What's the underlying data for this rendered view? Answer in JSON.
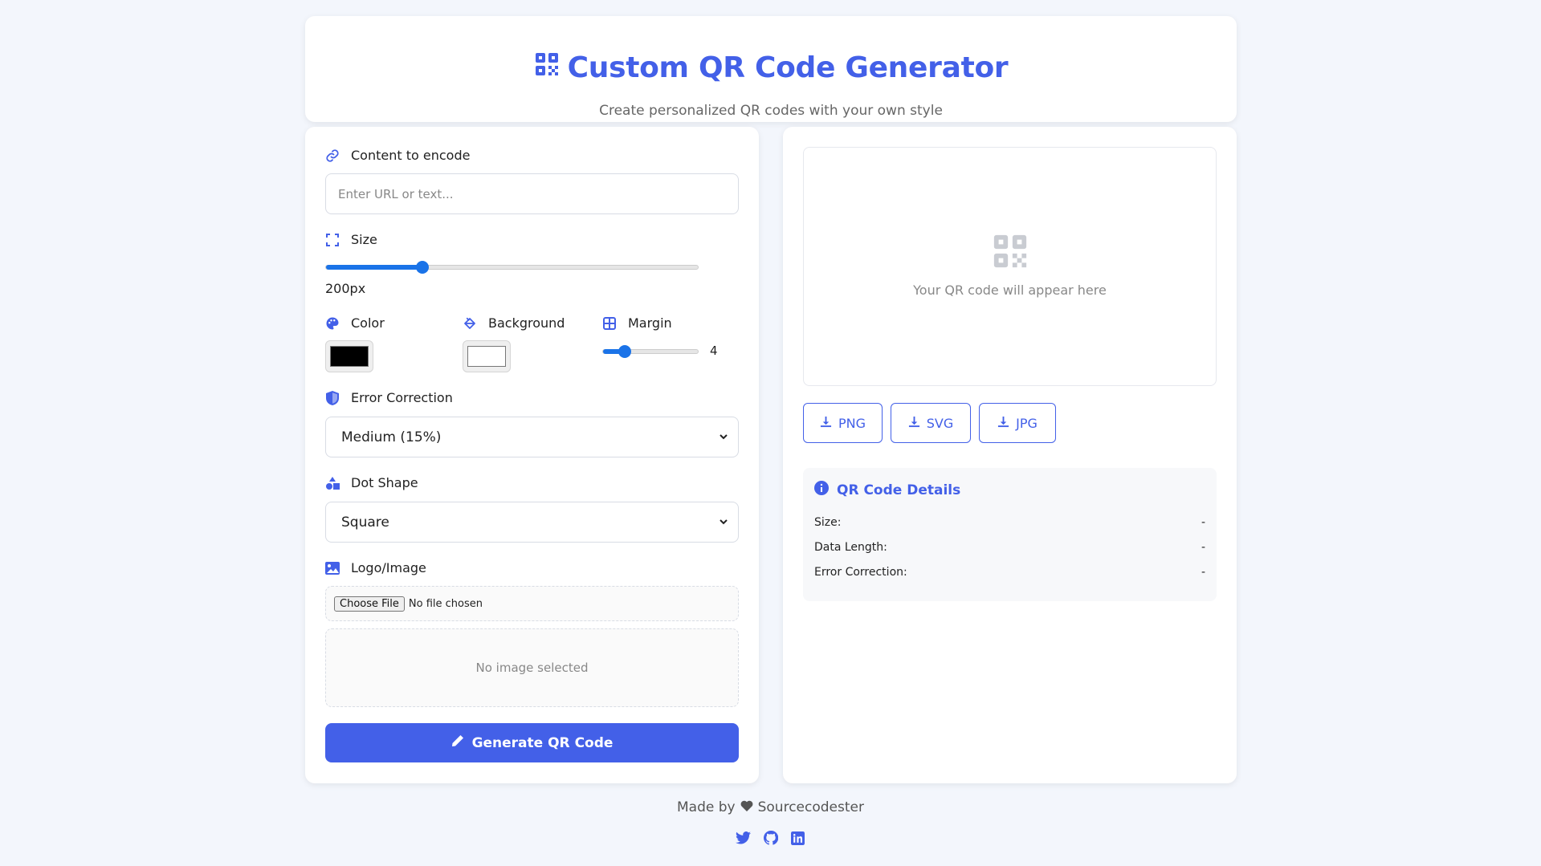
{
  "header": {
    "title": "Custom QR Code Generator",
    "subtitle": "Create personalized QR codes with your own style",
    "icon": "qrcode-icon"
  },
  "form": {
    "content": {
      "label": "Content to encode",
      "placeholder": "Enter URL or text...",
      "value": "",
      "icon": "link-icon"
    },
    "size": {
      "label": "Size",
      "value_text": "200px",
      "value": 200,
      "fraction": 0.26,
      "icon": "expand-icon"
    },
    "color": {
      "label": "Color",
      "value": "#000000",
      "icon": "palette-icon"
    },
    "background": {
      "label": "Background",
      "value": "#ffffff",
      "icon": "fill-drip-icon"
    },
    "margin": {
      "label": "Margin",
      "value": "4",
      "fraction": 0.23,
      "icon": "grid-icon"
    },
    "error_correction": {
      "label": "Error Correction",
      "selected": "Medium (15%)",
      "icon": "shield-icon"
    },
    "dot_shape": {
      "label": "Dot Shape",
      "selected": "Square",
      "icon": "shapes-icon"
    },
    "logo": {
      "label": "Logo/Image",
      "button": "Choose File",
      "status": "No file chosen",
      "preview": "No image selected",
      "icon": "image-icon"
    },
    "generate_label": "Generate QR Code"
  },
  "preview": {
    "placeholder": "Your QR code will appear here",
    "downloads": [
      "PNG",
      "SVG",
      "JPG"
    ]
  },
  "details": {
    "title": "QR Code Details",
    "rows": [
      {
        "label": "Size:",
        "value": "-"
      },
      {
        "label": "Data Length:",
        "value": "-"
      },
      {
        "label": "Error Correction:",
        "value": "-"
      }
    ]
  },
  "footer": {
    "made_by": "Made by",
    "author": "Sourcecodester",
    "socials": [
      "twitter-icon",
      "github-icon",
      "linkedin-icon"
    ]
  },
  "colors": {
    "accent": "#4360e8",
    "slider": "#1a73e8",
    "background": "#f3f6fc"
  }
}
